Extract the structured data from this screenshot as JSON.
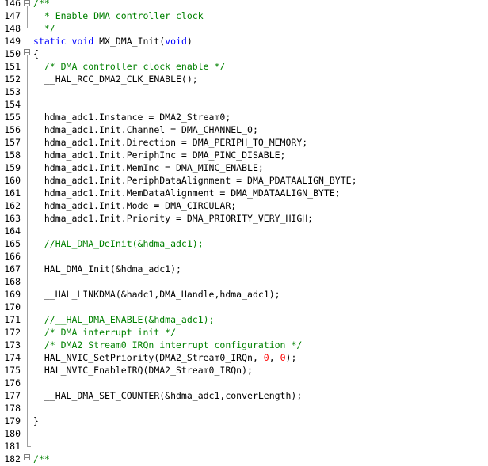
{
  "editor": {
    "lines": [
      {
        "num": "146",
        "tokens": [
          {
            "t": "/**",
            "c": "comment"
          }
        ]
      },
      {
        "num": "147",
        "tokens": [
          {
            "t": "  * Enable DMA controller clock",
            "c": "comment"
          }
        ]
      },
      {
        "num": "148",
        "tokens": [
          {
            "t": "  */",
            "c": "comment"
          }
        ]
      },
      {
        "num": "149",
        "tokens": [
          {
            "t": "static",
            "c": "kw"
          },
          {
            "t": " ",
            "c": "plain"
          },
          {
            "t": "void",
            "c": "kw"
          },
          {
            "t": " MX_DMA_Init(",
            "c": "plain"
          },
          {
            "t": "void",
            "c": "kw"
          },
          {
            "t": ")",
            "c": "plain"
          }
        ]
      },
      {
        "num": "150",
        "tokens": [
          {
            "t": "{",
            "c": "plain"
          }
        ]
      },
      {
        "num": "151",
        "tokens": [
          {
            "t": "  /* DMA controller clock enable */",
            "c": "comment"
          }
        ]
      },
      {
        "num": "152",
        "tokens": [
          {
            "t": "  __HAL_RCC_DMA2_CLK_ENABLE();",
            "c": "plain"
          }
        ]
      },
      {
        "num": "153",
        "tokens": []
      },
      {
        "num": "154",
        "tokens": []
      },
      {
        "num": "155",
        "tokens": [
          {
            "t": "  hdma_adc1.Instance = DMA2_Stream0;",
            "c": "plain"
          }
        ]
      },
      {
        "num": "156",
        "tokens": [
          {
            "t": "  hdma_adc1.Init.Channel = DMA_CHANNEL_0;",
            "c": "plain"
          }
        ]
      },
      {
        "num": "157",
        "tokens": [
          {
            "t": "  hdma_adc1.Init.Direction = DMA_PERIPH_TO_MEMORY;",
            "c": "plain"
          }
        ]
      },
      {
        "num": "158",
        "tokens": [
          {
            "t": "  hdma_adc1.Init.PeriphInc = DMA_PINC_DISABLE;",
            "c": "plain"
          }
        ]
      },
      {
        "num": "159",
        "tokens": [
          {
            "t": "  hdma_adc1.Init.MemInc = DMA_MINC_ENABLE;",
            "c": "plain"
          }
        ]
      },
      {
        "num": "160",
        "tokens": [
          {
            "t": "  hdma_adc1.Init.PeriphDataAlignment = DMA_PDATAALIGN_BYTE;",
            "c": "plain"
          }
        ]
      },
      {
        "num": "161",
        "tokens": [
          {
            "t": "  hdma_adc1.Init.MemDataAlignment = DMA_MDATAALIGN_BYTE;",
            "c": "plain"
          }
        ]
      },
      {
        "num": "162",
        "tokens": [
          {
            "t": "  hdma_adc1.Init.Mode = DMA_CIRCULAR;",
            "c": "plain"
          }
        ]
      },
      {
        "num": "163",
        "tokens": [
          {
            "t": "  hdma_adc1.Init.Priority = DMA_PRIORITY_VERY_HIGH;",
            "c": "plain"
          }
        ]
      },
      {
        "num": "164",
        "tokens": []
      },
      {
        "num": "165",
        "tokens": [
          {
            "t": "  //HAL_DMA_DeInit(&hdma_adc1);",
            "c": "comment"
          }
        ]
      },
      {
        "num": "166",
        "tokens": []
      },
      {
        "num": "167",
        "tokens": [
          {
            "t": "  HAL_DMA_Init(&hdma_adc1);",
            "c": "plain"
          }
        ]
      },
      {
        "num": "168",
        "tokens": []
      },
      {
        "num": "169",
        "tokens": [
          {
            "t": "  __HAL_LINKDMA(&hadc1,DMA_Handle,hdma_adc1);",
            "c": "plain"
          }
        ]
      },
      {
        "num": "170",
        "tokens": []
      },
      {
        "num": "171",
        "tokens": [
          {
            "t": "  //__HAL_DMA_ENABLE(&hdma_adc1);",
            "c": "comment"
          }
        ]
      },
      {
        "num": "172",
        "tokens": [
          {
            "t": "  /* DMA interrupt init */",
            "c": "comment"
          }
        ]
      },
      {
        "num": "173",
        "tokens": [
          {
            "t": "  /* DMA2_Stream0_IRQn interrupt configuration */",
            "c": "comment"
          }
        ]
      },
      {
        "num": "174",
        "tokens": [
          {
            "t": "  HAL_NVIC_SetPriority(DMA2_Stream0_IRQn, ",
            "c": "plain"
          },
          {
            "t": "0",
            "c": "num"
          },
          {
            "t": ", ",
            "c": "plain"
          },
          {
            "t": "0",
            "c": "num"
          },
          {
            "t": ");",
            "c": "plain"
          }
        ]
      },
      {
        "num": "175",
        "tokens": [
          {
            "t": "  HAL_NVIC_EnableIRQ(DMA2_Stream0_IRQn);",
            "c": "plain"
          }
        ]
      },
      {
        "num": "176",
        "tokens": []
      },
      {
        "num": "177",
        "tokens": [
          {
            "t": "  __HAL_DMA_SET_COUNTER(&hdma_adc1,converLength);",
            "c": "plain"
          }
        ]
      },
      {
        "num": "178",
        "tokens": []
      },
      {
        "num": "179",
        "tokens": [
          {
            "t": "}",
            "c": "plain"
          }
        ]
      },
      {
        "num": "180",
        "tokens": []
      },
      {
        "num": "181",
        "tokens": []
      },
      {
        "num": "182",
        "tokens": [
          {
            "t": "/**",
            "c": "comment"
          }
        ]
      }
    ],
    "colors": {
      "comment": "#008000",
      "keyword": "#0000ff",
      "number": "#ff0000",
      "text": "#000000",
      "background": "#ffffff"
    }
  }
}
